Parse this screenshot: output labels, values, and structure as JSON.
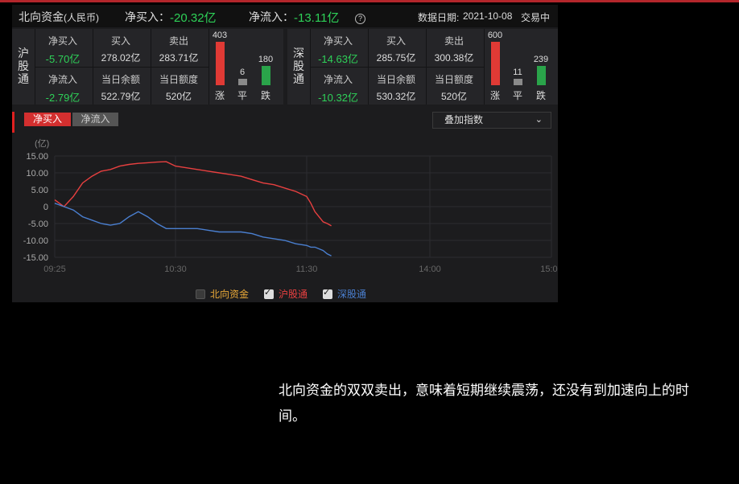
{
  "header": {
    "title": "北向资金",
    "unit": "(人民币)",
    "net_buy_label": "净买入：",
    "net_buy_value": "-20.32亿",
    "net_inflow_label": "净流入：",
    "net_inflow_value": "-13.11亿",
    "help_icon": "question-circle-icon",
    "date_label": "数据日期:",
    "date_value": "2021-10-08",
    "status": "交易中"
  },
  "hgt": {
    "name_chars": [
      "沪",
      "股",
      "通"
    ],
    "net_buy_label": "净买入",
    "net_buy_value": "-5.70亿",
    "buy_label": "买入",
    "buy_value": "278.02亿",
    "sell_label": "卖出",
    "sell_value": "283.71亿",
    "net_inflow_label": "净流入",
    "net_inflow_value": "-2.79亿",
    "balance_label": "当日余额",
    "balance_value": "522.79亿",
    "quota_label": "当日额度",
    "quota_value": "520亿",
    "up": "403",
    "flat": "6",
    "down": "180",
    "up_label": "涨",
    "flat_label": "平",
    "down_label": "跌"
  },
  "sgt": {
    "name_chars": [
      "深",
      "股",
      "通"
    ],
    "net_buy_label": "净买入",
    "net_buy_value": "-14.63亿",
    "buy_label": "买入",
    "buy_value": "285.75亿",
    "sell_label": "卖出",
    "sell_value": "300.38亿",
    "net_inflow_label": "净流入",
    "net_inflow_value": "-10.32亿",
    "balance_label": "当日余额",
    "balance_value": "530.32亿",
    "quota_label": "当日额度",
    "quota_value": "520亿",
    "up": "600",
    "flat": "11",
    "down": "239",
    "up_label": "涨",
    "flat_label": "平",
    "down_label": "跌"
  },
  "tabs": {
    "active": "净买入",
    "inactive": "净流入"
  },
  "dropdown": {
    "label": "叠加指数",
    "icon": "chevron-down-icon"
  },
  "legend": {
    "north": {
      "label": "北向资金",
      "checked": false,
      "color": "#e8a838"
    },
    "hgt": {
      "label": "沪股通",
      "checked": true,
      "color": "#e84040"
    },
    "sgt": {
      "label": "深股通",
      "checked": true,
      "color": "#4a7fd0"
    }
  },
  "colors": {
    "up": "#e03a35",
    "down": "#2aa44a",
    "flat": "#8a8a8a",
    "accent_red": "#d32f2f"
  },
  "chart_data": {
    "type": "line",
    "ylabel": "(亿)",
    "ylim": [
      -15,
      15
    ],
    "yticks": [
      "15.00",
      "10.00",
      "5.00",
      "0",
      "-5.00",
      "-10.00",
      "-15.00"
    ],
    "xticks": [
      "09:25",
      "10:30",
      "11:30",
      "14:00",
      "15:00"
    ],
    "grid": true,
    "series": [
      {
        "name": "沪股通",
        "color": "#e84040",
        "x": [
          "09:25",
          "09:30",
          "09:35",
          "09:40",
          "09:45",
          "09:50",
          "09:55",
          "10:00",
          "10:05",
          "10:10",
          "10:15",
          "10:20",
          "10:25",
          "10:30",
          "10:35",
          "10:40",
          "10:45",
          "10:50",
          "10:55",
          "11:00",
          "11:05",
          "11:10",
          "11:15",
          "11:20",
          "11:25",
          "11:30",
          "11:35",
          "11:40",
          "11:45",
          "11:50",
          "11:55",
          "12:00"
        ],
        "y": [
          2,
          0,
          3,
          7,
          9,
          10.5,
          11,
          12,
          12.5,
          12.8,
          13,
          13.2,
          13.3,
          12,
          11.5,
          11,
          10.5,
          10,
          9.5,
          9,
          8,
          7,
          6.5,
          5.5,
          4.5,
          3,
          1,
          -1.5,
          -3,
          -4.5,
          -5,
          -5.7
        ]
      },
      {
        "name": "深股通",
        "color": "#4a7fd0",
        "x": [
          "09:25",
          "09:30",
          "09:35",
          "09:40",
          "09:45",
          "09:50",
          "09:55",
          "10:00",
          "10:05",
          "10:10",
          "10:15",
          "10:20",
          "10:25",
          "10:30",
          "10:35",
          "10:40",
          "10:45",
          "10:50",
          "10:55",
          "11:00",
          "11:05",
          "11:10",
          "11:15",
          "11:20",
          "11:25",
          "11:30",
          "11:35",
          "11:40",
          "11:45",
          "11:50",
          "11:55",
          "12:00"
        ],
        "y": [
          1,
          0,
          -1,
          -3,
          -4,
          -5,
          -5.5,
          -5,
          -3,
          -1.5,
          -3,
          -5,
          -6.5,
          -6.5,
          -6.5,
          -6.5,
          -7,
          -7.5,
          -7.5,
          -7.5,
          -8,
          -9,
          -9.5,
          -10,
          -11,
          -11.5,
          -12,
          -12,
          -12.5,
          -13,
          -14,
          -14.6
        ]
      }
    ]
  },
  "caption": "北向资金的双双卖出，意味着短期继续震荡，还没有到加速向上的时间。"
}
